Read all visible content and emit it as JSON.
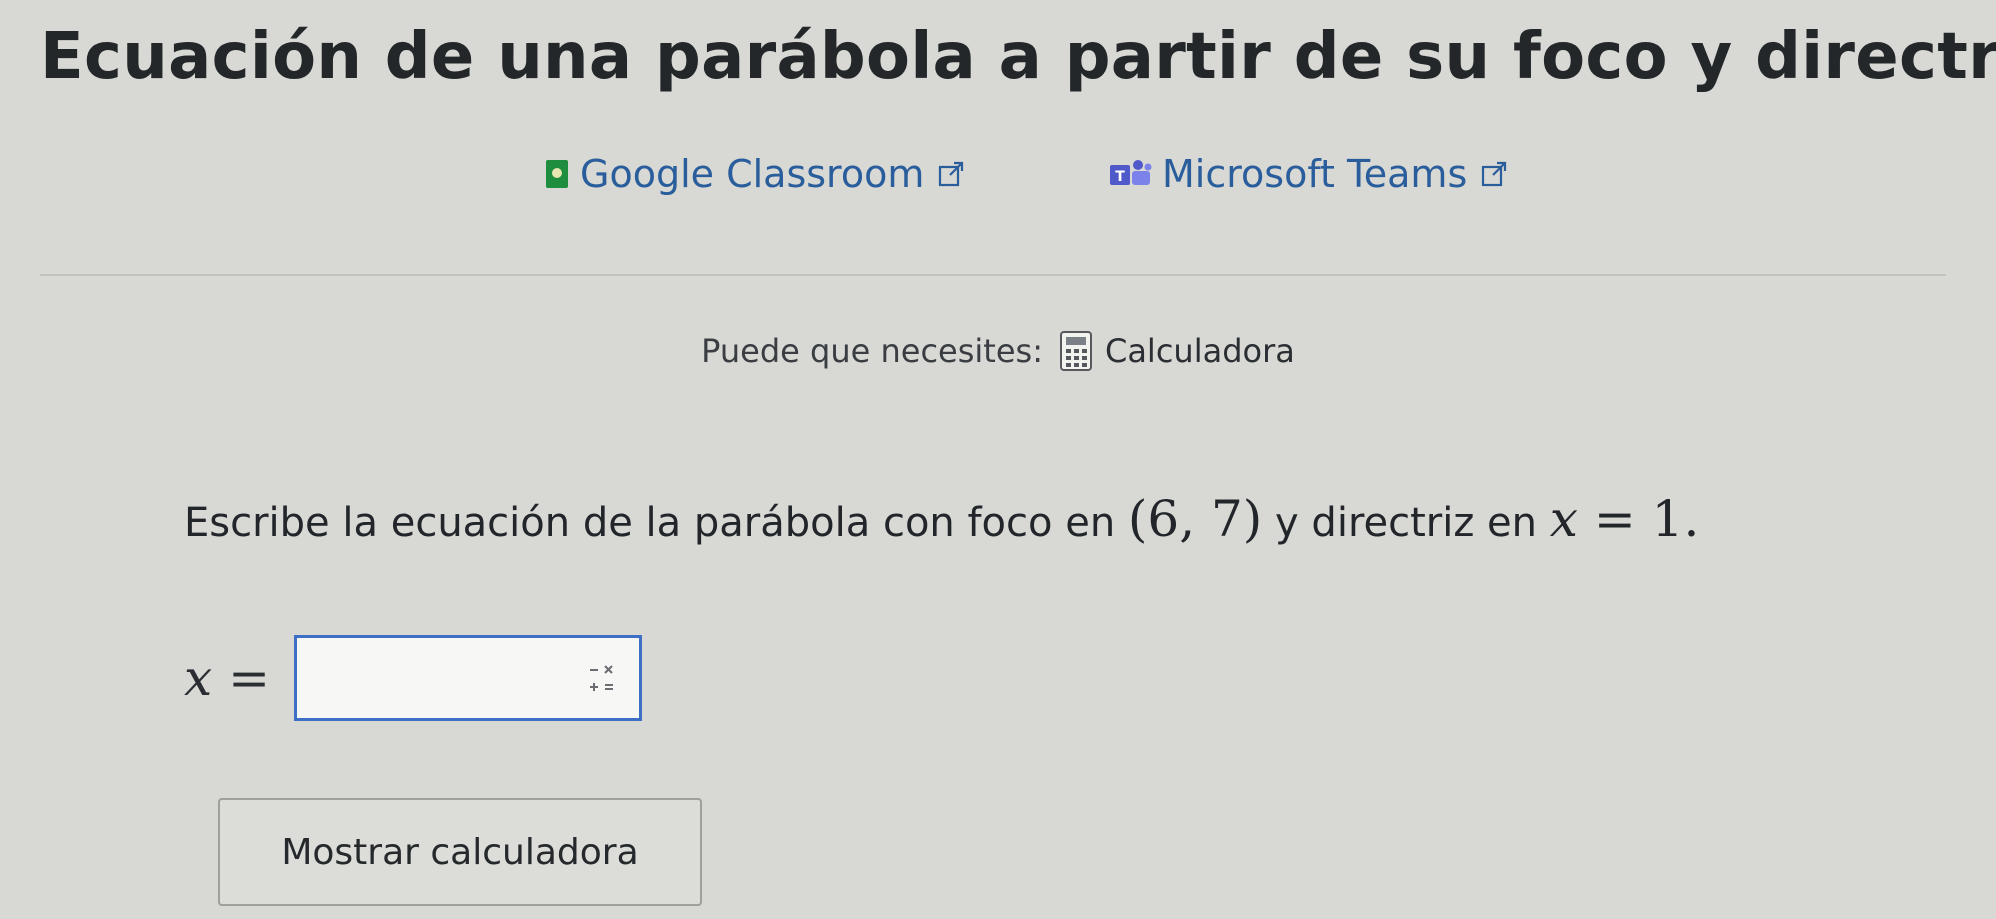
{
  "page": {
    "title": "Ecuación de una parábola a partir de su foco y directriz"
  },
  "share": {
    "classroom_label": "Google Classroom",
    "teams_label": "Microsoft Teams",
    "classroom_icon": "google-classroom-icon",
    "teams_icon": "microsoft-teams-icon",
    "external_icon": "external-link-icon"
  },
  "tools": {
    "prefix": "Puede que necesites:",
    "calculator_label": "Calculadora",
    "calculator_icon": "calculator-icon"
  },
  "problem": {
    "text_before": "Escribe la ecuación de la parábola con foco en",
    "focus": "(6, 7)",
    "text_middle": "y directriz en",
    "directrix_var": "x",
    "directrix_rest": " = 1.",
    "answer_var": "x",
    "answer_eq": " =",
    "answer_value": "",
    "ops_icon": "math-operators-icon"
  },
  "actions": {
    "show_calculator": "Mostrar calculadora"
  },
  "colors": {
    "background": "#d8d8d4",
    "link": "#2a5d9c",
    "input_border": "#3d6fc4"
  }
}
